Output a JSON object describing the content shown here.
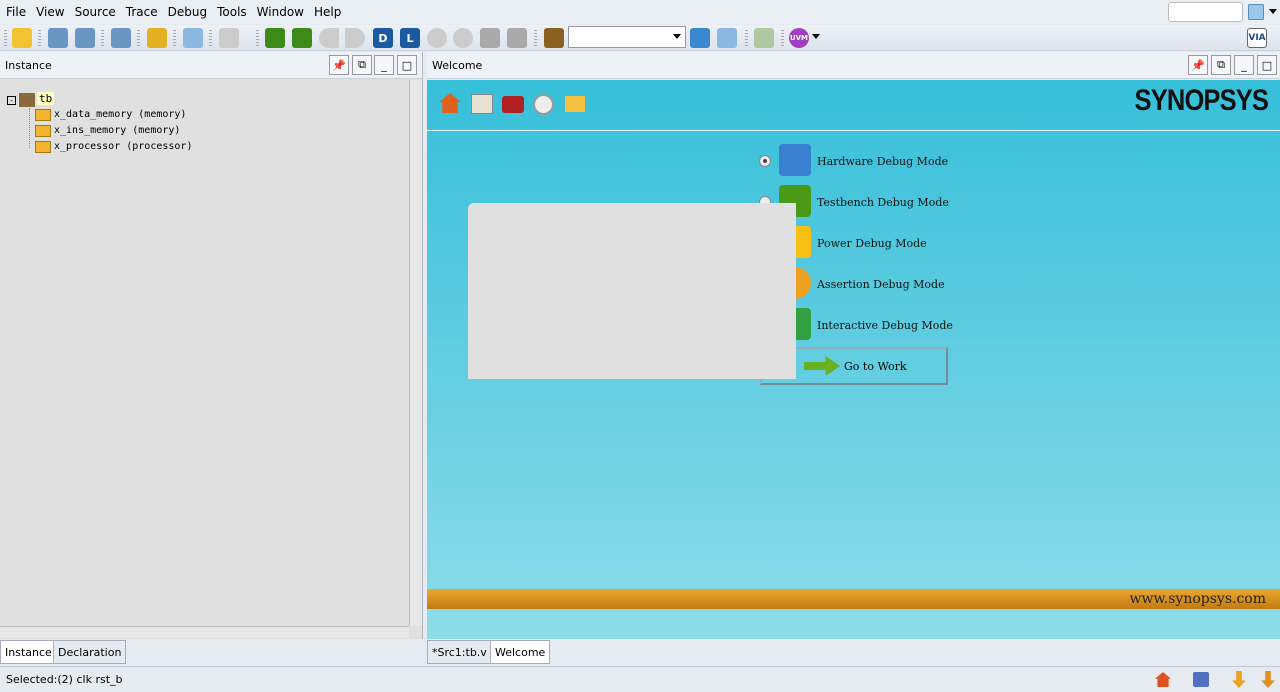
{
  "menu": [
    "File",
    "View",
    "Source",
    "Trace",
    "Debug",
    "Tools",
    "Window",
    "Help"
  ],
  "left_pane": {
    "title": "Instance",
    "tree": {
      "root": "tb",
      "children": [
        "x_data_memory (memory)",
        "x_ins_memory (memory)",
        "x_processor (processor)"
      ]
    },
    "tabs": [
      "Instance",
      "Declaration"
    ]
  },
  "right_pane": {
    "title": "Welcome",
    "tabs": [
      "*Src1:tb.v",
      "Welcome"
    ],
    "welcome": {
      "logo": "SYNOPSYS",
      "modes": [
        "Hardware Debug Mode",
        "Testbench Debug Mode",
        "Power Debug Mode",
        "Assertion Debug Mode",
        "Interactive Debug Mode"
      ],
      "selected_mode": "Hardware Debug Mode",
      "go_button": "Go to Work",
      "url": "www.synopsys.com"
    }
  },
  "toolbar": {
    "d_label": "D",
    "l_label": "L",
    "uvm_label": "UVM",
    "via_label": "VIA"
  },
  "status": "Selected:(2) clk rst_b"
}
